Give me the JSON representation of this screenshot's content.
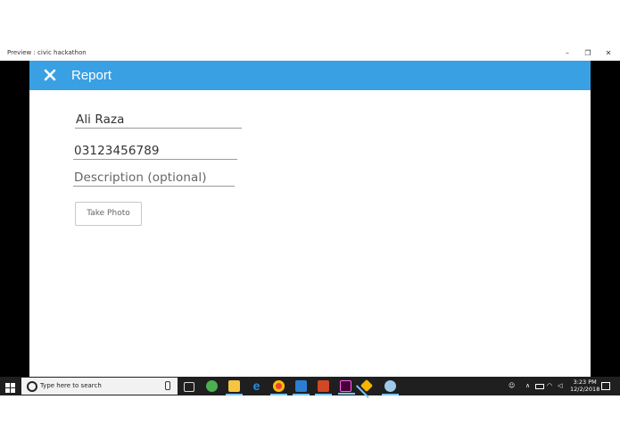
{
  "window": {
    "title": "Preview : civic hackathon",
    "minimize_glyph": "–",
    "restore_glyph": "❐",
    "close_glyph": "✕"
  },
  "header": {
    "title": "Report",
    "close_icon": "close-icon",
    "color": "#3aa0e4"
  },
  "form": {
    "name_value": "Ali Raza",
    "phone_value": "03123456789",
    "description_placeholder": "Description (optional)",
    "take_photo_label": "Take Photo"
  },
  "taskbar": {
    "search_placeholder": "Type here to search",
    "time": "3:23 PM",
    "date": "12/2/2018"
  }
}
